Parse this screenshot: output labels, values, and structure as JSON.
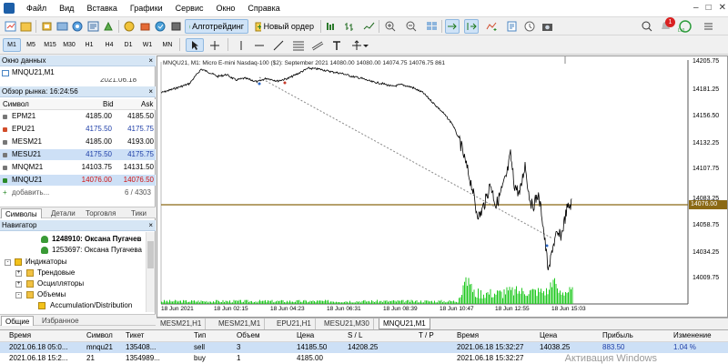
{
  "menu": [
    "Файл",
    "Вид",
    "Вставка",
    "Графики",
    "Сервис",
    "Окно",
    "Справка"
  ],
  "toolbar": {
    "algo": "Алготрейдинг",
    "new_order": "Новый ордер",
    "notif_count": "1",
    "lvl": "LVL"
  },
  "timeframes": [
    "M1",
    "M5",
    "M15",
    "M30",
    "H1",
    "H4",
    "D1",
    "W1",
    "MN"
  ],
  "active_timeframe": "M1",
  "data_window": {
    "title": "Окно данных",
    "symbol": "MNQU21,M1",
    "date": "2021.06.18"
  },
  "market_watch": {
    "title": "Обзор рынка: 16:24:56",
    "headers": {
      "symbol": "Символ",
      "bid": "Bid",
      "ask": "Ask"
    },
    "rows": [
      {
        "symbol": "EPM21",
        "bid": "4185.00",
        "ask": "4185.50",
        "color": "#000000"
      },
      {
        "symbol": "EPU21",
        "bid": "4175.50",
        "ask": "4175.75",
        "color": "#1e3ea8"
      },
      {
        "symbol": "MESM21",
        "bid": "4185.00",
        "ask": "4193.00",
        "color": "#000000"
      },
      {
        "symbol": "MESU21",
        "bid": "4175.50",
        "ask": "4175.75",
        "color": "#1e3ea8"
      },
      {
        "symbol": "MNQM21",
        "bid": "14103.75",
        "ask": "14131.50",
        "color": "#000000"
      },
      {
        "symbol": "MNQU21",
        "bid": "14076.00",
        "ask": "14076.50",
        "color": "#d01212"
      }
    ],
    "add_label": "добавить...",
    "count": "6 / 4303",
    "tabs": [
      "Символы",
      "Детали",
      "Торговля",
      "Тики"
    ]
  },
  "navigator": {
    "title": "Навигатор",
    "accounts": [
      "1248910: Оксана Пугачев",
      "1253697: Оксана Пугачева"
    ],
    "items": [
      "Индикаторы",
      "Трендовые",
      "Осцилляторы",
      "Объемы",
      "Accumulation/Distribution"
    ],
    "tabs": [
      "Общие",
      "Избранное"
    ]
  },
  "chart": {
    "info": "MNQU21, M1:  Micro E-mini Nasdaq-100 ($2): September 2021   14080.00 14080.00 14074.75 14076.75  861",
    "last_price": "14076.00",
    "price_labels": [
      "14205.75",
      "14181.25",
      "14156.50",
      "14132.25",
      "14107.75",
      "14083.25",
      "14058.75",
      "14034.25",
      "14009.75"
    ],
    "time_labels": [
      "18 Jun 2021",
      "18 Jun 02:15",
      "18 Jun 04:23",
      "18 Jun 06:31",
      "18 Jun 08:39",
      "18 Jun 10:47",
      "18 Jun 12:55",
      "18 Jun 15:03"
    ]
  },
  "chart_tabs": [
    "MESM21,H1",
    "MESM21,M1",
    "EPU21,H1",
    "MESU21,M30",
    "MNQU21,M1"
  ],
  "active_chart_tab": "MNQU21,M1",
  "trades": {
    "headers": [
      "Время",
      "Символ",
      "Тикет",
      "Тип",
      "Объем",
      "Цена",
      "S / L",
      "T / P",
      "Время",
      "Цена",
      "Прибыль",
      "Изменение"
    ],
    "rows": [
      [
        "2021.06.18 05:0...",
        "mnqu21",
        "135408...",
        "sell",
        "3",
        "14185.50",
        "14208.25",
        "",
        "2021.06.18 15:32:27",
        "14038.25",
        "883.50",
        "1.04 %"
      ],
      [
        "2021.06.18 15:2...",
        "21",
        "1354989...",
        "buy",
        "1",
        "4185.00",
        "",
        "",
        "2021.06.18 15:32:27",
        "",
        "",
        ""
      ]
    ]
  },
  "watermark": "Активация Windows",
  "colors": {
    "accent": "#1d5fa8",
    "ask_red": "#d01212",
    "bid_blue": "#1e3ea8",
    "level": "#8b6914",
    "volume": "#1fc91f"
  }
}
